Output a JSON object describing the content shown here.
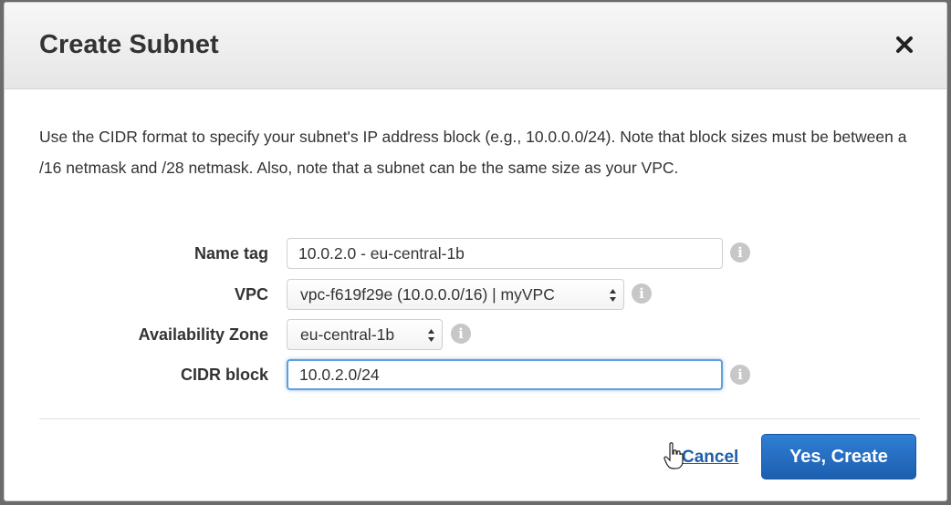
{
  "dialog": {
    "title": "Create Subnet",
    "close_label": "×",
    "description": "Use the CIDR format to specify your subnet's IP address block (e.g., 10.0.0.0/24). Note that block sizes must be between a /16 netmask and /28 netmask. Also, note that a subnet can be the same size as your VPC."
  },
  "form": {
    "name_tag": {
      "label": "Name tag",
      "value": "10.0.2.0 - eu-central-1b"
    },
    "vpc": {
      "label": "VPC",
      "selected": "vpc-f619f29e (10.0.0.0/16) | myVPC"
    },
    "availability_zone": {
      "label": "Availability Zone",
      "selected": "eu-central-1b"
    },
    "cidr_block": {
      "label": "CIDR block",
      "value": "10.0.2.0/24"
    },
    "info_glyph": "i"
  },
  "footer": {
    "cancel_label": "Cancel",
    "create_label": "Yes, Create"
  },
  "colors": {
    "primary": "#1d5fb0",
    "link": "#1f5fa8",
    "focus": "#5fa0dc"
  }
}
